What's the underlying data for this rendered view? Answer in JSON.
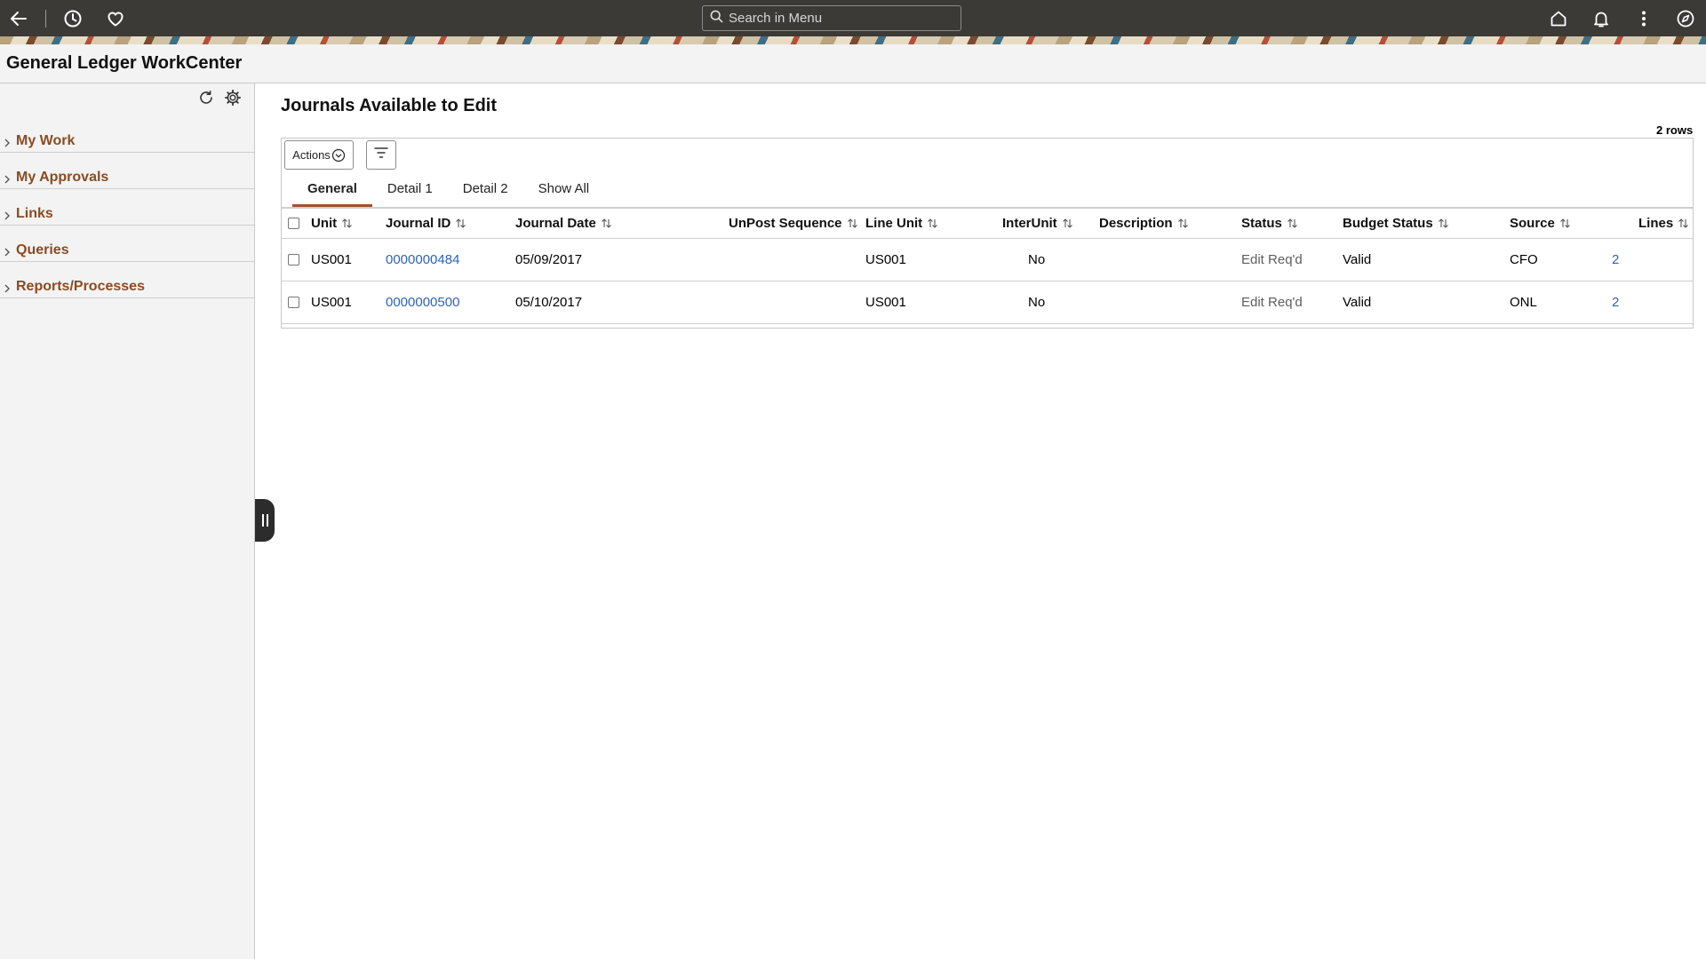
{
  "topbar": {
    "back_icon": "back-arrow-icon",
    "history_icon": "clock-icon",
    "favorites_icon": "heart-icon",
    "search_placeholder": "Search in Menu",
    "home_icon": "home-icon",
    "notifications_icon": "bell-icon",
    "actions_icon": "vertical-dots-icon",
    "navbar_icon": "compass-icon"
  },
  "page_title": "General Ledger WorkCenter",
  "left_panel": {
    "refresh_icon": "refresh-icon",
    "settings_icon": "gear-icon",
    "items": [
      {
        "label": "My Work"
      },
      {
        "label": "My Approvals"
      },
      {
        "label": "Links"
      },
      {
        "label": "Queries"
      },
      {
        "label": "Reports/Processes"
      }
    ]
  },
  "main": {
    "title": "Journals Available to Edit",
    "row_count": "2 rows",
    "actions_label": "Actions",
    "tabs": [
      {
        "label": "General",
        "active": true
      },
      {
        "label": "Detail 1",
        "active": false
      },
      {
        "label": "Detail 2",
        "active": false
      },
      {
        "label": "Show All",
        "active": false
      }
    ],
    "columns": {
      "unit": "Unit",
      "journal_id": "Journal ID",
      "journal_date": "Journal Date",
      "unpost_sequence": "UnPost Sequence",
      "line_unit": "Line Unit",
      "interunit": "InterUnit",
      "description": "Description",
      "status": "Status",
      "budget_status": "Budget Status",
      "source": "Source",
      "lines": "Lines"
    },
    "rows": [
      {
        "unit": "US001",
        "journal_id": "0000000484",
        "journal_date": "05/09/2017",
        "unpost_sequence": "",
        "line_unit": "US001",
        "interunit": "No",
        "description": "",
        "status": "Edit Req'd",
        "budget_status": "Valid",
        "source": "CFO",
        "lines": "2"
      },
      {
        "unit": "US001",
        "journal_id": "0000000500",
        "journal_date": "05/10/2017",
        "unpost_sequence": "",
        "line_unit": "US001",
        "interunit": "No",
        "description": "",
        "status": "Edit Req'd",
        "budget_status": "Valid",
        "source": "ONL",
        "lines": "2"
      }
    ]
  },
  "colors": {
    "header_bg": "#3c3a37",
    "nav_link": "#8a4b23",
    "data_link": "#2c63b8",
    "tab_underline": "#a0522d"
  }
}
